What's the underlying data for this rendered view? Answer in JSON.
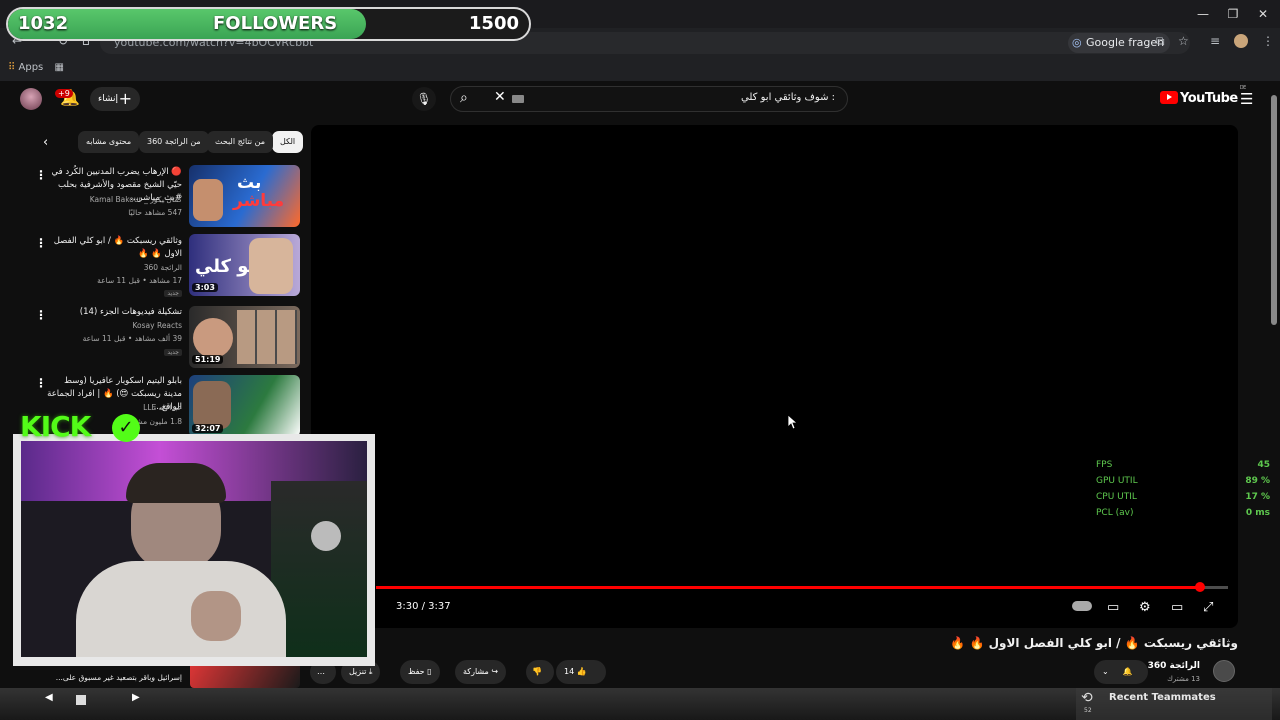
{
  "followers": {
    "current": "1032",
    "label": "FOLLOWERS",
    "goal": "1500",
    "progress": 0.688
  },
  "browser": {
    "url": "youtube.com/watch?v=4bOCvRcbbt",
    "google_ask": "Google fragen",
    "bookmarks_apps": "Apps"
  },
  "youtube": {
    "create_label": "إنشاء",
    "notif_count": "+9",
    "search_query": ": شوف وثائقي ابو كلي",
    "logo_text": "YouTube",
    "logo_country": "DE"
  },
  "chips": [
    {
      "label": "الكل",
      "active": true
    },
    {
      "label": "من نتائج البحث"
    },
    {
      "label": "من الرائجة 360"
    },
    {
      "label": "محتوى مشابه"
    }
  ],
  "videos": [
    {
      "title": "🔴 الإرهاب يضرب المدنيين الكُرد في حيّي الشيخ مقصود والأشرفية بحلب #بث_مباشر...",
      "channel": "كمال بكور _ Kamal Bakour",
      "meta": "547 مشاهد حاليًا",
      "duration": "",
      "new": ""
    },
    {
      "title": "وثائقي ريسبكت 🔥 / ابو كلي الفصل الاول 🔥 🔥",
      "channel": "الرائجة 360",
      "meta": "17 مشاهد • قبل 11 ساعة",
      "duration": "3:03",
      "new": "جديد"
    },
    {
      "title": "تشكيلة فيديوهات الجزء (14)",
      "channel": "Kosay Reacts",
      "meta": "39 ألف مشاهد • قبل 11 ساعة",
      "duration": "51:19",
      "new": "جديد"
    },
    {
      "title": "بابلو اليتيم اسكوبار عافيريا (وسط مدينة ريسبكت 😍) 🔥 | افراد الجماعة الواقع...",
      "channel": "عبدالاله LLE",
      "meta": "1.8 مليون مشاهد",
      "duration": "32:07",
      "new": ""
    }
  ],
  "last_video_title": "إسرائيل وباقر بتصعيد غير مسبوق على...",
  "player": {
    "time": "3:30 / 3:37",
    "progress": 0.967,
    "perf": [
      {
        "label": "FPS",
        "value": "45"
      },
      {
        "label": "GPU UTIL",
        "value": "89 %"
      },
      {
        "label": "CPU UTIL",
        "value": "17 %"
      },
      {
        "label": "PCL (av)",
        "value": "0 ms"
      }
    ]
  },
  "video": {
    "title": "وثائقي ريسبكت 🔥 / ابو كلي الفصل الاول 🔥 🔥",
    "channel": "الرائجة 360",
    "subs": "13 مشترك",
    "likes": "14",
    "share": "مشاركة",
    "save": "حفظ",
    "download": "تنزيل"
  },
  "teammates": {
    "title": "Recent Teammates",
    "count": "52"
  },
  "overlay": {
    "kick_text": "KICK"
  },
  "colors": {
    "accent": "#ff0000",
    "kick": "#53fc18",
    "perf": "#5ec84e"
  }
}
